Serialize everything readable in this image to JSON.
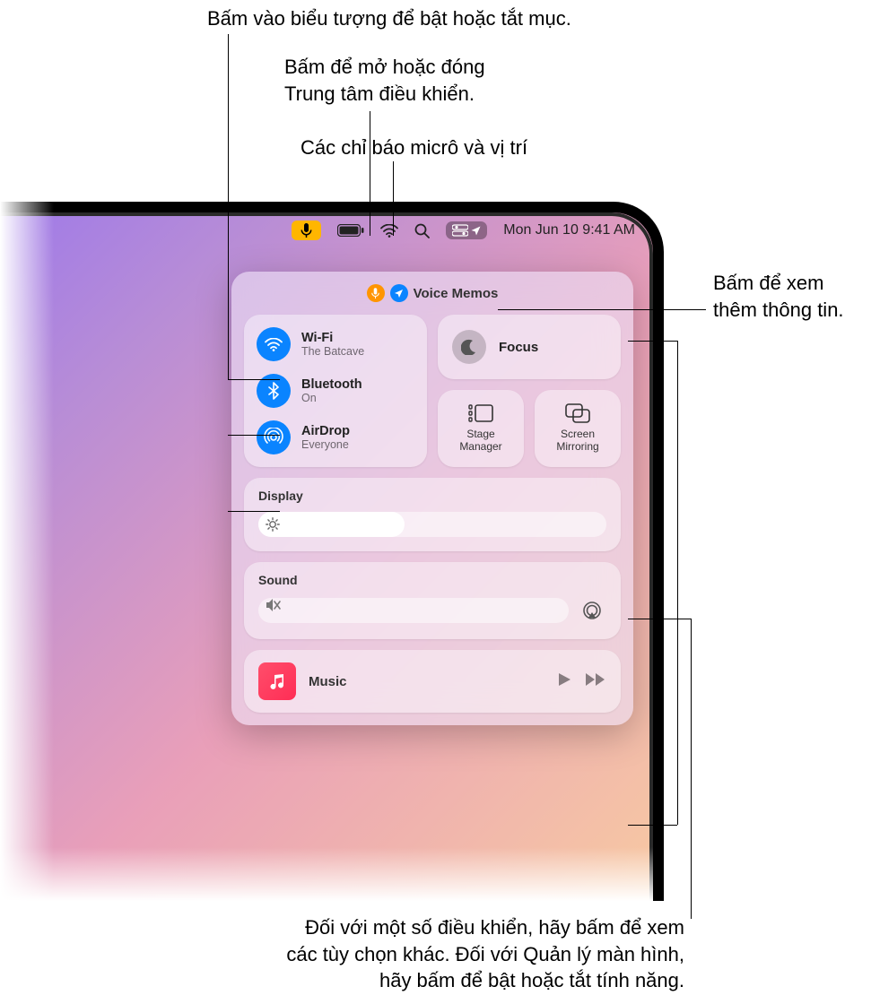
{
  "callouts": {
    "toggle_icons": "Bấm vào biểu tượng để bật hoặc tắt mục.",
    "open_close_cc": "Bấm để mở hoặc đóng\nTrung tâm điều khiển.",
    "mic_loc_indicators": "Các chỉ báo micrô và vị trí",
    "more_info": "Bấm để xem\nthêm thông tin.",
    "controls_hint": "Đối với một số điều khiển, hãy bấm để xem\ncác tùy chọn khác. Đối với Quản lý màn hình,\nhãy bấm để bật hoặc tắt tính năng."
  },
  "menubar": {
    "datetime": "Mon Jun 10  9:41 AM"
  },
  "controlcenter": {
    "active_app": "Voice Memos",
    "wifi": {
      "label": "Wi-Fi",
      "status": "The Batcave"
    },
    "bluetooth": {
      "label": "Bluetooth",
      "status": "On"
    },
    "airdrop": {
      "label": "AirDrop",
      "status": "Everyone"
    },
    "focus": {
      "label": "Focus"
    },
    "stage_manager": {
      "label": "Stage\nManager"
    },
    "screen_mirroring": {
      "label": "Screen\nMirroring"
    },
    "display": {
      "label": "Display",
      "value_pct": 42
    },
    "sound": {
      "label": "Sound",
      "value_pct": 0
    },
    "music": {
      "label": "Music"
    }
  }
}
